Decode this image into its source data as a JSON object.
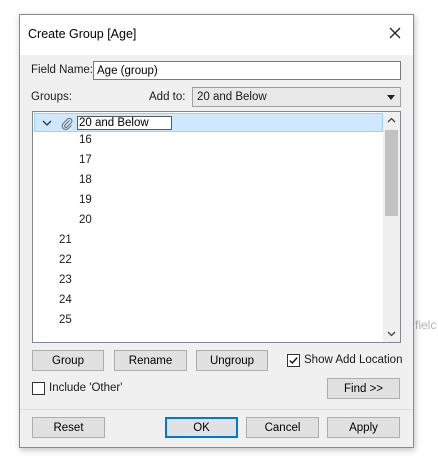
{
  "background_text": "fielc",
  "dialog": {
    "title": "Create Group [Age]"
  },
  "form": {
    "field_name_label": "Field Name:",
    "field_name_value": "Age (group)",
    "groups_label": "Groups:",
    "add_to_label": "Add to:",
    "add_to_value": "20 and Below"
  },
  "tree": {
    "group": {
      "name": "20 and Below",
      "members": [
        "16",
        "17",
        "18",
        "19",
        "20"
      ]
    },
    "ungrouped": [
      "21",
      "22",
      "23",
      "24",
      "25"
    ]
  },
  "buttons": {
    "group": "Group",
    "rename": "Rename",
    "ungroup": "Ungroup",
    "find": "Find >>",
    "reset": "Reset",
    "ok": "OK",
    "cancel": "Cancel",
    "apply": "Apply"
  },
  "checkboxes": {
    "show_add_location": {
      "label": "Show Add Location",
      "checked": true
    },
    "include_other": {
      "label": "Include 'Other'",
      "checked": false
    }
  },
  "icons": {
    "close": "close-icon",
    "expand": "chevron-down-icon",
    "group": "paperclip-icon",
    "dropdown": "caret-down-icon"
  },
  "colors": {
    "selection_fill": "#cde8ff",
    "selection_border": "#99d1ff",
    "default_button_border": "#0078d7"
  }
}
